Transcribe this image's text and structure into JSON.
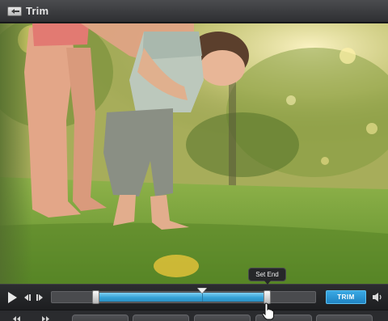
{
  "window": {
    "title": "Trim"
  },
  "icons": {
    "back": "back-arrow-icon",
    "play": "play-icon",
    "step_back": "step-back-icon",
    "step_forward": "step-forward-icon",
    "volume": "volume-icon",
    "cursor": "hand-pointer-icon"
  },
  "player": {
    "trim_label": "TRIM",
    "tooltip": "Set End",
    "trim_start": 0.17,
    "trim_end": 0.82,
    "playhead": 0.57
  },
  "colors": {
    "accent": "#2f99d3",
    "selection": "#35a1d6",
    "titlebar": "#3b3c3f"
  }
}
